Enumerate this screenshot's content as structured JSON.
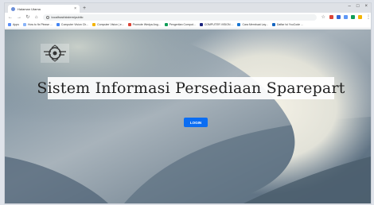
{
  "browser": {
    "tab_title": "Halaman Utama",
    "url": "localhost/sistem/public",
    "bookmarks": [
      {
        "label": "Apps",
        "icon": "apps-grid-icon",
        "color": "#5b8ff9"
      },
      {
        "label": "How to fix Please ...",
        "icon": "page-icon",
        "color": "#8ab4f8"
      },
      {
        "label": "Computer Vision Ch...",
        "icon": "globe-icon",
        "color": "#4285f4"
      },
      {
        "label": "Computer Vision | e...",
        "icon": "page-icon",
        "color": "#f4b400"
      },
      {
        "label": "Promote Wedya Ang...",
        "icon": "page-icon",
        "color": "#db4437"
      },
      {
        "label": "Pengertian Comput...",
        "icon": "globe-icon",
        "color": "#0f9d58"
      },
      {
        "label": "COMPUTER VISION ...",
        "icon": "page-icon",
        "color": "#1a237e"
      },
      {
        "label": "Cara Membuat Lay...",
        "icon": "page-icon",
        "color": "#1976d2"
      },
      {
        "label": "Daftar Isi YouCode ...",
        "icon": "page-icon",
        "color": "#1565c0"
      }
    ],
    "extension_colors": [
      "#db4437",
      "#3367d6",
      "#5e97f6",
      "#0f9d58",
      "#f4b400"
    ]
  },
  "page": {
    "heading": "Sistem Informasi Persediaan Sparepart",
    "login_label": "LOGIN",
    "accent_color": "#0b6df2"
  }
}
